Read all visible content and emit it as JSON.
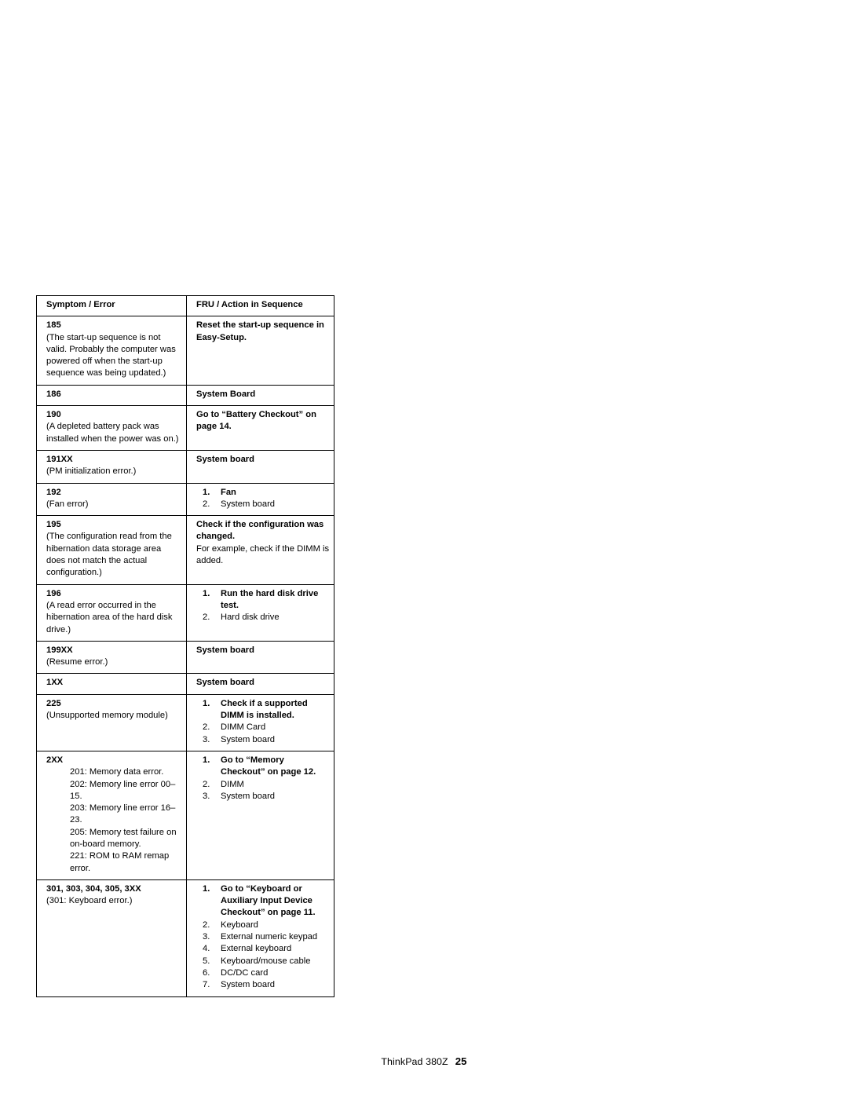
{
  "document": {
    "footer": {
      "product": "ThinkPad 380Z",
      "page_number": "25"
    }
  },
  "table": {
    "headers": {
      "symptom": "Symptom / Error",
      "fru": "FRU / Action in Sequence"
    },
    "rows": [
      {
        "code": "185",
        "description": "(The start-up sequence is not valid.  Probably the computer was powered off when the start-up sequence was being updated.)",
        "fru_bold": "Reset the start-up sequence in Easy-Setup.",
        "fru_items": []
      },
      {
        "code": "186",
        "description": "",
        "fru_bold": "System Board",
        "fru_items": []
      },
      {
        "code": "190",
        "description": "(A depleted battery pack was installed when the power was on.)",
        "fru_bold": "Go to “Battery Checkout” on page  14.",
        "fru_items": []
      },
      {
        "code": "191XX",
        "description": "(PM initialization error.)",
        "fru_bold": "System board",
        "fru_items": []
      },
      {
        "code": "192",
        "description": "(Fan error)",
        "fru_bold": "",
        "fru_items": [
          {
            "num": "1.",
            "text": "Fan",
            "bold": true
          },
          {
            "num": "2.",
            "text": "System board",
            "bold": false
          }
        ]
      },
      {
        "code": "195",
        "description": "(The configuration read from the hibernation data storage area does not match the actual configuration.)",
        "fru_bold": "Check if the configuration was changed.",
        "fru_plain": "For example, check if the DIMM is added.",
        "fru_items": []
      },
      {
        "code": "196",
        "description": "(A read error occurred in the hibernation area of the hard disk drive.)",
        "fru_bold": "",
        "fru_items": [
          {
            "num": "1.",
            "text": "Run the hard disk drive test.",
            "bold": true
          },
          {
            "num": "2.",
            "text": "Hard disk drive",
            "bold": false
          }
        ]
      },
      {
        "code": "199XX",
        "description": "(Resume error.)",
        "fru_bold": "System board",
        "fru_items": []
      },
      {
        "code": "1XX",
        "description": "",
        "fru_bold": "System board",
        "fru_items": []
      },
      {
        "code": "225",
        "description": "(Unsupported memory module)",
        "fru_bold": "",
        "fru_items": [
          {
            "num": "1.",
            "text": "Check if a supported DIMM is installed.",
            "bold": true
          },
          {
            "num": "2.",
            "text": "DIMM Card",
            "bold": false
          },
          {
            "num": "3.",
            "text": "System board",
            "bold": false
          }
        ]
      },
      {
        "code": "2XX",
        "description_indented": "201: Memory data error. 202: Memory line error 00–15. 203: Memory line error 16–23. 205: Memory test failure on on-board memory. 221: ROM to RAM remap error.",
        "description_lines": [
          "201:  Memory data error.",
          "202:  Memory line error 00–15.",
          "203:  Memory line error 16–23.",
          "205:  Memory test failure on on-board memory.",
          "221:  ROM to RAM remap error."
        ],
        "fru_bold": "",
        "fru_items": [
          {
            "num": "1.",
            "text": "Go to “Memory Checkout” on page  12.",
            "bold": true
          },
          {
            "num": "2.",
            "text": "DIMM",
            "bold": false
          },
          {
            "num": "3.",
            "text": "System board",
            "bold": false
          }
        ]
      },
      {
        "code": "301, 303, 304, 305, 3XX",
        "description": "(301:  Keyboard error.)",
        "fru_bold": "",
        "fru_items": [
          {
            "num": "1.",
            "text": "Go to “Keyboard or Auxiliary Input Device Checkout” on page  11.",
            "bold": true
          },
          {
            "num": "2.",
            "text": "Keyboard",
            "bold": false
          },
          {
            "num": "3.",
            "text": "External numeric keypad",
            "bold": false
          },
          {
            "num": "4.",
            "text": "External keyboard",
            "bold": false
          },
          {
            "num": "5.",
            "text": "Keyboard/mouse cable",
            "bold": false
          },
          {
            "num": "6.",
            "text": "DC/DC card",
            "bold": false
          },
          {
            "num": "7.",
            "text": "System board",
            "bold": false
          }
        ]
      }
    ]
  }
}
